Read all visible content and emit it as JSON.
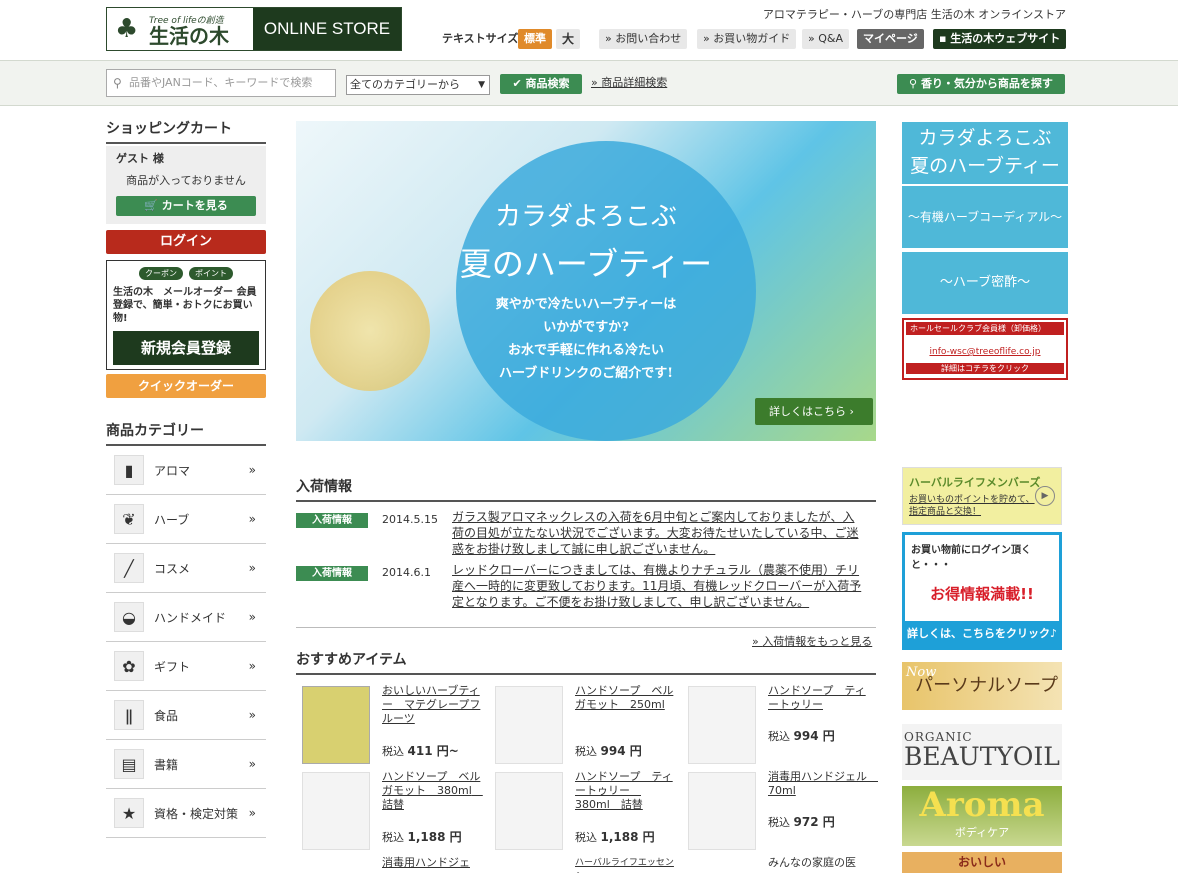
{
  "header": {
    "logo_tag": "Tree of lifeの創造",
    "logo_name": "生活の木",
    "logo_store": "ONLINE STORE",
    "tagline": "アロマテラピー・ハーブの専門店 生活の木 オンラインストア",
    "text_size_label": "テキストサイズ",
    "size_normal": "標準",
    "size_large": "大",
    "contact": "お問い合わせ",
    "guide": "お買い物ガイド",
    "qa": "Q&A",
    "mypage": "マイページ",
    "website": "生活の木ウェブサイト"
  },
  "search": {
    "placeholder": "品番やJANコード、キーワードで検索",
    "category": "全てのカテゴリーから",
    "search_button": "商品検索",
    "advanced": "商品詳細検索",
    "scent_button": "香り・気分から商品を探す"
  },
  "cart": {
    "title": "ショッピングカート",
    "guest": "ゲスト 様",
    "empty": "商品が入っておりません",
    "view_cart": "カートを見る",
    "login": "ログイン"
  },
  "member": {
    "pill1": "クーポン",
    "pill2": "ポイント",
    "text1": "生活の木　メールオーダー 会員",
    "text2": "登録で、簡単・おトクにお買い物!",
    "register": "新規会員登録",
    "quick_order": "クイックオーダー"
  },
  "categories": {
    "title": "商品カテゴリー",
    "items": [
      {
        "label": "アロマ",
        "icon": "bottle-icon"
      },
      {
        "label": "ハーブ",
        "icon": "herb-icon"
      },
      {
        "label": "コスメ",
        "icon": "cosme-icon"
      },
      {
        "label": "ハンドメイド",
        "icon": "mortar-icon"
      },
      {
        "label": "ギフト",
        "icon": "ribbon-icon"
      },
      {
        "label": "食品",
        "icon": "cutlery-icon"
      },
      {
        "label": "書籍",
        "icon": "book-icon"
      },
      {
        "label": "資格・検定対策",
        "icon": "star-icon"
      }
    ]
  },
  "hero": {
    "line1": "カラダよろこぶ",
    "line2": "夏のハーブティー",
    "sub1": "爽やかで冷たいハーブティーは",
    "sub2": "いかがですか?",
    "sub3": "お水で手軽に作れる冷たい",
    "sub4": "ハーブドリンクのご紹介です!",
    "button": "詳しくはこちら"
  },
  "news": {
    "title": "入荷情報",
    "items": [
      {
        "badge": "入荷情報",
        "date": "2014.5.15",
        "text": "ガラス製アロマネックレスの入荷を6月中旬とご案内しておりましたが、入荷の目処が立たない状況でございます。大変お待たせいたしている中、ご迷惑をお掛け致しまして誠に申し訳ございません。"
      },
      {
        "badge": "入荷情報",
        "date": "2014.6.1",
        "text": "レッドクローバーにつきましては、有機よりナチュラル（農薬不使用）チリ産へ一時的に変更致しております。11月頃、有機レッドクローバーが入荷予定となります。ご不便をお掛け致しまして、申し訳ございません。"
      }
    ],
    "more": "入荷情報をもっと見る"
  },
  "recommend": {
    "title": "おすすめアイテム",
    "items": [
      {
        "name": "おいしいハーブティー　マテグレープフルーツ",
        "price_label": "税込",
        "price": "411 円~"
      },
      {
        "name": "ハンドソープ　ベルガモット　250ml",
        "price_label": "税込",
        "price": "994 円"
      },
      {
        "name": "ハンドソープ　ティートゥリー",
        "price_label": "税込",
        "price": "994 円"
      },
      {
        "name": "ハンドソープ　ベルガモット　380ml　詰替",
        "price_label": "税込",
        "price": "1,188 円"
      },
      {
        "name": "ハンドソープ　ティートゥリー　380ml　詰替",
        "price_label": "税込",
        "price": "1,188 円"
      },
      {
        "name": "消毒用ハンドジェル　70ml",
        "price_label": "税込",
        "price": "972 円"
      },
      {
        "name": "消毒用ハンドジェ",
        "price_label": "",
        "price": ""
      },
      {
        "name": "ハーバルライフエッセンシャ",
        "price_label": "",
        "price": ""
      },
      {
        "name": "みんなの家庭の医",
        "price_label": "",
        "price": ""
      }
    ]
  },
  "right": {
    "b1_l1": "カラダよろこぶ",
    "b1_l2": "夏のハーブティー",
    "b2": "～有機ハーブコーディアル～",
    "b3": "～ハーブ密酢～",
    "b4_head": "ホールセールクラブ会員様（卸価格）",
    "b4_mail": "info-wsc@treeoflife.co.jp",
    "b4_foot": "詳細はコチラをクリック",
    "b5_title": "ハーバルライフメンバーズ",
    "b5_sub1": "お買いものポイントを貯めて、",
    "b5_sub2": "指定商品と交換！",
    "b6_a": "お買い物前にログイン頂くと・・・",
    "b6_b": "お得情報満載!!",
    "b6_c": "詳しくは、こちらをクリック♪",
    "b7_now": "Now",
    "b7": "パーソナルソープ",
    "b8_o": "ORGANIC",
    "b8_b": "BEAUTYOIL",
    "b9_a": "Aroma",
    "b9_b": "ボディケア",
    "b10": "おいしい"
  }
}
